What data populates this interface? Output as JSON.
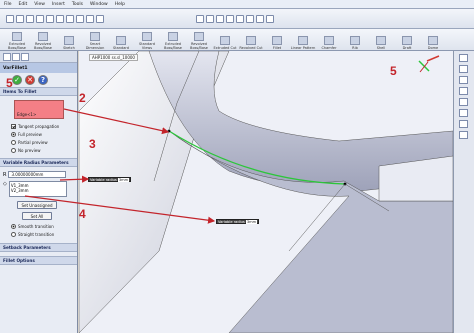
{
  "menu": [
    "File",
    "Edit",
    "View",
    "Insert",
    "Tools",
    "Window",
    "Help"
  ],
  "command_manager": [
    {
      "label": "Extruded Boss/Base"
    },
    {
      "label": "Revolved Boss/Base"
    },
    {
      "label": "Sketch"
    },
    {
      "label": "Smart Dimension"
    },
    {
      "label": "Standard"
    },
    {
      "label": "Standard Views"
    },
    {
      "label": "Extruded Boss/Base"
    },
    {
      "label": "Revolved Boss/Base"
    },
    {
      "label": "Extruded Cut"
    },
    {
      "label": "Revolved Cut"
    },
    {
      "label": "Fillet"
    },
    {
      "label": "Linear Pattern"
    },
    {
      "label": "Chamfer"
    },
    {
      "label": "Rib"
    },
    {
      "label": "Shell"
    },
    {
      "label": "Draft"
    },
    {
      "label": "Dome"
    }
  ],
  "feature": {
    "title": "VarFillet1"
  },
  "panel": {
    "items_group": "Items To Fillet",
    "edge_value": "Edge<1>",
    "tangent_label": "Tangent propagation",
    "full_label": "Full preview",
    "partial_label": "Partial preview",
    "nopreview_label": "No preview",
    "varparams_group": "Variable Radius Parameters",
    "radius_value": "3.00000000mm",
    "vertex1": "V1_3mm",
    "vertex2": "V2_3mm",
    "set_unassigned": "Set Unassigned",
    "set_all": "Set All",
    "smooth_label": "Smooth transition",
    "straight_label": "Straight transition",
    "setback_group": "Setback Parameters",
    "fillet_options_group": "Fillet Options"
  },
  "viewport": {
    "doc_tab": "AHP1000 ss.sl_10000",
    "callout1_label": "Variable radius",
    "callout1_value": "3mm",
    "callout2_label": "Variable radius",
    "callout2_value": "3mm"
  },
  "steps": {
    "s2": "2",
    "s3": "3",
    "s4": "4",
    "s5a": "5",
    "s5b": "5"
  },
  "colors": {
    "accent": "#c3242b",
    "highlight_edge": "#2cc63a",
    "selection_box": "#f47f86"
  }
}
